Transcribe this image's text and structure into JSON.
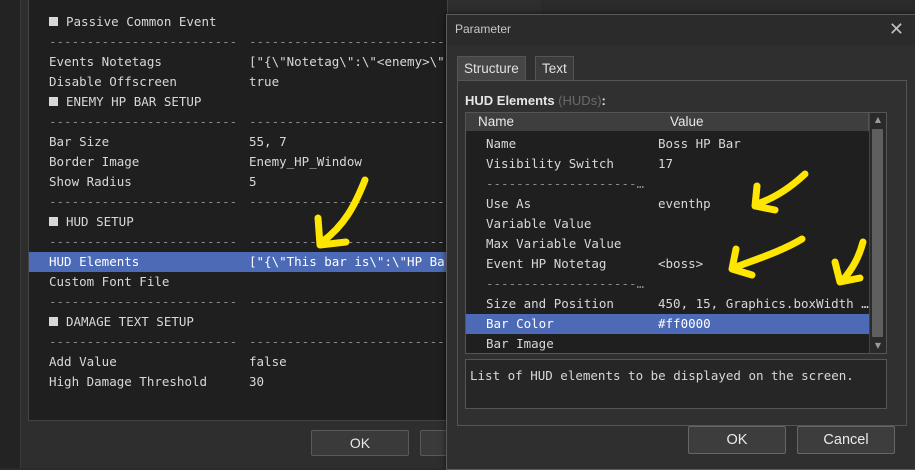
{
  "background": {
    "rows": [
      {
        "type": "header",
        "key": "Passive Common Event",
        "value": ""
      },
      {
        "type": "sep",
        "key": "-------------------------",
        "value": "--------------------------"
      },
      {
        "type": "item",
        "key": "Events Notetags",
        "value": "[\"{\\\"Notetag\\\":\\\"<enemy>\\\",\\"
      },
      {
        "type": "item",
        "key": "Disable Offscreen",
        "value": "true"
      },
      {
        "type": "header",
        "key": "ENEMY HP BAR SETUP",
        "value": ""
      },
      {
        "type": "sep",
        "key": "-------------------------",
        "value": "--------------------------"
      },
      {
        "type": "item",
        "key": "Bar Size",
        "value": "55, 7"
      },
      {
        "type": "item",
        "key": "Border Image",
        "value": "Enemy_HP_Window"
      },
      {
        "type": "item",
        "key": "Show Radius",
        "value": "5"
      },
      {
        "type": "sep",
        "key": "-------------------------",
        "value": "--------------------------"
      },
      {
        "type": "header",
        "key": "HUD SETUP",
        "value": ""
      },
      {
        "type": "sep",
        "key": "-------------------------",
        "value": "--------------------------"
      },
      {
        "type": "selected",
        "key": "HUD Elements",
        "value": "[\"{\\\"This bar is\\\":\\\"HP Bar\\"
      },
      {
        "type": "item",
        "key": "Custom Font File",
        "value": ""
      },
      {
        "type": "sep",
        "key": "-------------------------",
        "value": "--------------------------"
      },
      {
        "type": "header",
        "key": "DAMAGE TEXT SETUP",
        "value": ""
      },
      {
        "type": "sep",
        "key": "-------------------------",
        "value": "--------------------------"
      },
      {
        "type": "item",
        "key": "Add Value",
        "value": "false"
      },
      {
        "type": "item",
        "key": "High Damage Threshold",
        "value": "30"
      }
    ],
    "ok_label": "OK"
  },
  "dialog": {
    "title": "Parameter",
    "close_glyph": "✕",
    "tabs": [
      "Structure",
      "Text"
    ],
    "field_label": "HUD Elements",
    "field_hint": "(HUDs)",
    "field_colon": ":",
    "columns": [
      "Name",
      "Value"
    ],
    "rows": [
      {
        "type": "item",
        "key": "Name",
        "value": "Boss HP Bar"
      },
      {
        "type": "item",
        "key": "Visibility Switch",
        "value": "17"
      },
      {
        "type": "sep",
        "key": "--------------------…",
        "value": ""
      },
      {
        "type": "item",
        "key": "Use As",
        "value": "eventhp"
      },
      {
        "type": "item",
        "key": "Variable Value",
        "value": ""
      },
      {
        "type": "item",
        "key": "Max Variable Value",
        "value": ""
      },
      {
        "type": "item",
        "key": "Event HP Notetag",
        "value": "<boss>"
      },
      {
        "type": "sep",
        "key": "--------------------…",
        "value": ""
      },
      {
        "type": "item",
        "key": "Size and Position",
        "value": "450, 15, Graphics.boxWidth …"
      },
      {
        "type": "selected",
        "key": "Bar Color",
        "value": "#ff0000"
      },
      {
        "type": "item",
        "key": "Bar Image",
        "value": ""
      }
    ],
    "scroll_up": "▲",
    "scroll_down": "▼",
    "description": "List of HUD elements to be displayed on the screen.",
    "ok_label": "OK",
    "cancel_label": "Cancel"
  },
  "colors": {
    "accent": "#4c6ab5",
    "annotation": "#ffe600"
  }
}
